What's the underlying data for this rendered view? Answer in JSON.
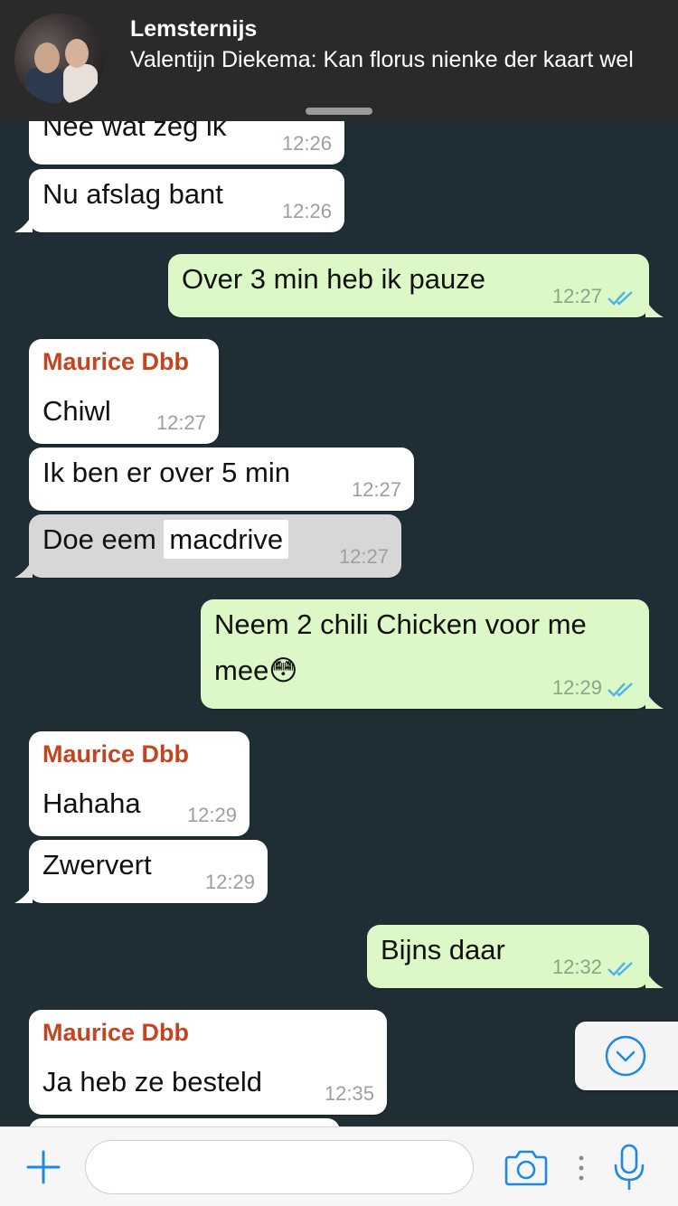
{
  "notification": {
    "title": "Lemsternijs",
    "body": "Valentijn Diekema: Kan florus nienke der kaart wel"
  },
  "messages": [
    {
      "text": "Nee wat zeg ik",
      "time": "12:26"
    },
    {
      "text": "Nu afslag bant",
      "time": "12:26"
    },
    {
      "text": "Over 3 min heb ik pauze",
      "time": "12:27"
    },
    {
      "sender": "Maurice Dbb",
      "text": "Chiwl",
      "time": "12:27"
    },
    {
      "text": "Ik ben er over 5 min",
      "time": "12:27"
    },
    {
      "text_before": "Doe eem",
      "highlight": "macdrive",
      "time": "12:27"
    },
    {
      "text": "Neem 2 chili Chicken voor me mee😳",
      "time": "12:29"
    },
    {
      "sender": "Maurice Dbb",
      "text": "Hahaha",
      "time": "12:29"
    },
    {
      "text": "Zwervert",
      "time": "12:29"
    },
    {
      "text": "Bijns daar",
      "time": "12:32"
    },
    {
      "sender": "Maurice Dbb",
      "text": "Ja heb ze besteld",
      "time": "12:35"
    }
  ],
  "colors": {
    "background": "#1f2d35",
    "incoming": "#ffffff",
    "outgoing": "#dcf8c6",
    "sender": "#c4441f",
    "read_ticks": "#4fb3e8",
    "accent": "#1e88e5"
  },
  "icons": {
    "add": "plus-icon",
    "camera": "camera-icon",
    "more": "dots-icon",
    "mic": "microphone-icon",
    "scroll": "chevron-down-icon",
    "read": "double-check-icon"
  }
}
